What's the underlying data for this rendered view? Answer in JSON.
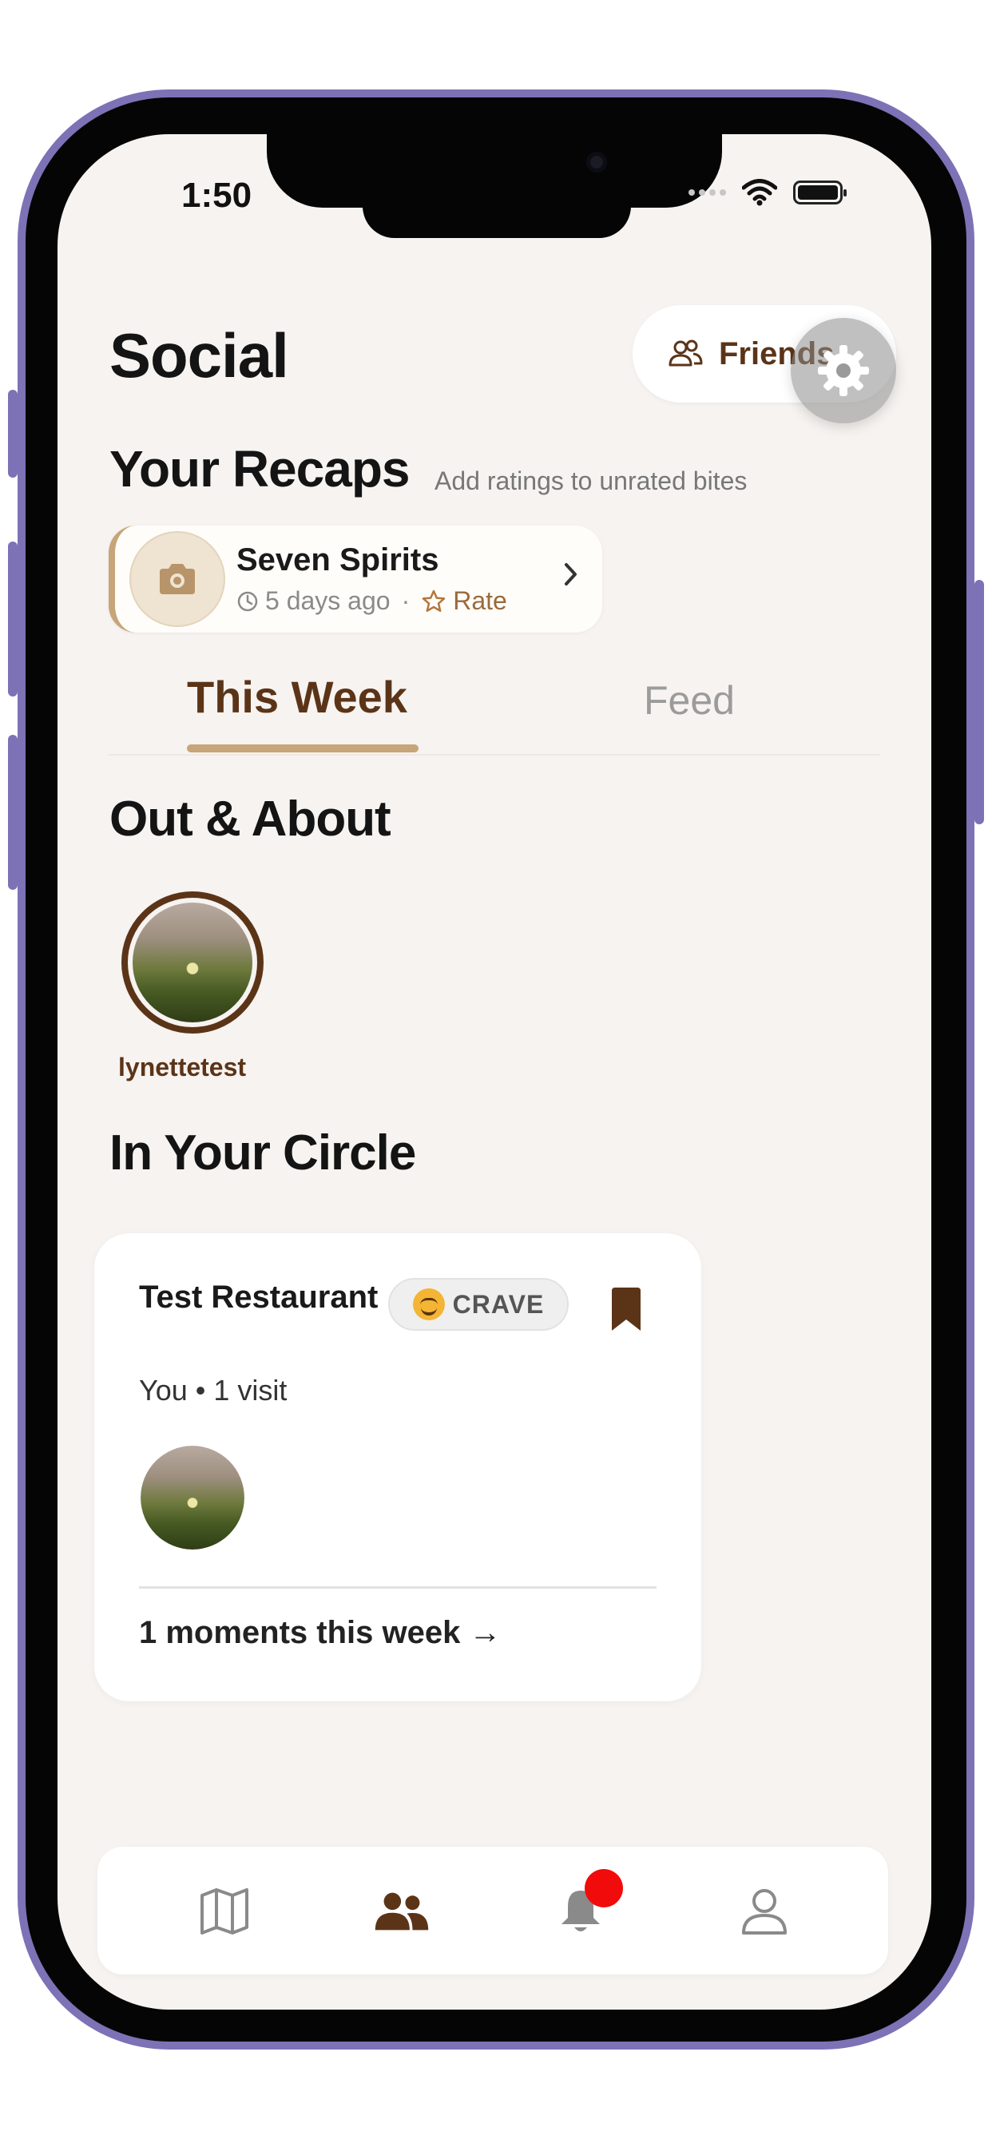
{
  "status_bar": {
    "time": "1:50"
  },
  "header": {
    "title": "Social",
    "friends_label": "Friends"
  },
  "recaps": {
    "title": "Your Recaps",
    "hint": "Add ratings to unrated bites",
    "items": [
      {
        "name": "Seven Spirits",
        "time_ago": "5 days ago",
        "separator": "·",
        "action": "Rate"
      }
    ]
  },
  "tabs": [
    {
      "label": "This Week",
      "active": true
    },
    {
      "label": "Feed",
      "active": false
    }
  ],
  "out_and_about": {
    "title": "Out & About",
    "people": [
      {
        "username": "lynettetest"
      }
    ]
  },
  "in_your_circle": {
    "title": "In Your Circle",
    "cards": [
      {
        "restaurant": "Test Restaurant",
        "badge": "CRAVE",
        "subtitle": "You • 1 visit",
        "moments_link": "1 moments this week →"
      }
    ]
  },
  "tab_bar": {
    "items": [
      "map-icon",
      "people-icon",
      "bell-icon",
      "profile-icon"
    ],
    "active": "people-icon",
    "notification_dot": true
  },
  "colors": {
    "brand_brown": "#5b3418",
    "accent_tan": "#c6a57a",
    "background": "#f6f3f0",
    "notification_red": "#f20b0b",
    "frame_purple": "#7c72b5"
  }
}
